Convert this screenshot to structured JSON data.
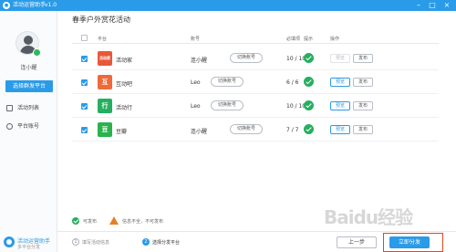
{
  "window": {
    "title": "活动运营助手",
    "version": "v1.0",
    "controls": {
      "minimize": "–",
      "maximize": "□",
      "close": "×"
    }
  },
  "sidebar": {
    "username": "连小醒",
    "primary_button": "选择群发平台",
    "items": [
      {
        "label": "活动列表",
        "icon": "list-icon"
      },
      {
        "label": "平台账号",
        "icon": "user-icon"
      }
    ],
    "bottom": {
      "name": "活动运营助手",
      "sub": "多平台分发"
    }
  },
  "main": {
    "title": "春季户外赏花活动",
    "columns": [
      "平台",
      "账号",
      "必填项",
      "提示",
      "操作"
    ],
    "rows": [
      {
        "platform": "活动家",
        "logo_text": "活动家",
        "logo_color": "#e8573a",
        "account": "连小醒",
        "switch": "切换账号",
        "required": "10 / 10",
        "preview": "预览",
        "publish": "发布",
        "preview_enabled": false
      },
      {
        "platform": "互动吧",
        "logo_text": "互",
        "logo_color": "#ef6a3a",
        "account": "Leo",
        "switch": "切换账号",
        "required": "6 / 6",
        "preview": "预览",
        "publish": "发布",
        "preview_enabled": true
      },
      {
        "platform": "活动行",
        "logo_text": "行",
        "logo_color": "#27ae60",
        "account": "Leo",
        "switch": "切换账号",
        "required": "10 / 10",
        "preview": "预览",
        "publish": "发布",
        "preview_enabled": true
      },
      {
        "platform": "豆瓣",
        "logo_text": "豆",
        "logo_color": "#2bb24c",
        "account": "连小醒",
        "switch": "切换账号",
        "required": "7 / 7",
        "preview": "预览",
        "publish": "发布",
        "preview_enabled": true
      }
    ]
  },
  "legend": {
    "ok": "可发布",
    "warn": "信息不全，不可发布"
  },
  "footer": {
    "steps": [
      {
        "num": "1",
        "label": "填写活动信息"
      },
      {
        "num": "2",
        "label": "选择分发平台"
      }
    ],
    "prev_button": "上一步",
    "publish_button": "立即分发"
  },
  "watermark": "Baidu经验",
  "colors": {
    "accent": "#2a9be8",
    "success": "#27ae60",
    "warning": "#e67e22",
    "highlight": "#e2471c"
  }
}
